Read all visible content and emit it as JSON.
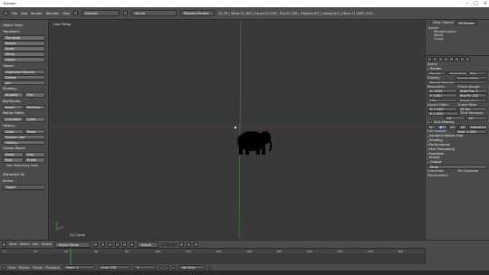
{
  "window": {
    "title": "Blender",
    "controls": [
      "–",
      "□",
      "×"
    ]
  },
  "info_header": {
    "menus": [
      "File",
      "Add",
      "Render",
      "Window",
      "Help"
    ],
    "layout": "Default",
    "scene": "Scene",
    "engine": "Blender Render",
    "stats": "v2.79 | Verts:11,180 | Faces:22,356 | Tris:22,356 | Objects:0/3 | Lamps:0/1 | Mem:11.34M | ELE..."
  },
  "toolshelf": {
    "header": "Object Tools",
    "transform_label": "Transform:",
    "transform": [
      "Translate",
      "Rotate",
      "Scale"
    ],
    "mirror": "Mirror",
    "origin": "Origin",
    "object_label": "Object:",
    "object": [
      "Duplicate Objects",
      "Delete",
      "Join"
    ],
    "shading_label": "Shading:",
    "shading": [
      "Smooth",
      "Flat"
    ],
    "keyframes_label": "Keyframes:",
    "keyframes": [
      "Insert",
      "Remove"
    ],
    "motion_label": "Motion Paths:",
    "motion": [
      "Calculate",
      "Clear"
    ],
    "history_label": "History:",
    "history_undo": [
      "Undo",
      "Redo"
    ],
    "repeat_last": "Repeat Last",
    "history": "History...",
    "grease_label": "Grease Pencil:",
    "grease_draw": [
      "Draw",
      "Line"
    ],
    "grease_poly": [
      "Poly",
      "Erase"
    ],
    "use_sketching": "Use Sketching Sess",
    "operator_header": "(De)select All",
    "action_label": "Action:",
    "action_value": "Toggle"
  },
  "viewport": {
    "label": "User Persp",
    "object_label": "(1) Curve",
    "silhouette": "elephant"
  },
  "outliner": {
    "view": "View",
    "search": "Search",
    "filter": "All Scenes",
    "items": [
      "Scene",
      "RenderLayers",
      "World",
      "Curve"
    ]
  },
  "properties": {
    "scene_label": "Scene",
    "render_header": "Render",
    "render_buttons": [
      "Render",
      "Animation",
      "Play"
    ],
    "display_label": "Display:",
    "display_value": "Image Editor",
    "presets": "Render Presets",
    "resolution_label": "Resolution:",
    "frame_range_label": "Frame Range:",
    "res_x": "X: 1920",
    "res_y": "Y: 1080",
    "res_pct": "50%",
    "start": "Start Fra: 1",
    "end": "End Fr: 250",
    "step": "Frame St: 1",
    "aspect_label": "Aspect Ratio:",
    "frame_rate_label": "Frame Rate:",
    "asp_x": "X: 1.000",
    "asp_y": "Y: 1.000",
    "fps": "24 fps",
    "time_remap_label": "Time Remapp:",
    "remap_old": "10",
    "remap_new": "10",
    "anti_alias": "Anti-Aliasing",
    "aa_values": [
      "5",
      "8",
      "11",
      "16"
    ],
    "aa_filter": "Mitchell-Net",
    "full_sample": "Full Sample",
    "size": "Size: 1.000",
    "sections": [
      "Sampled Motion Blur",
      "Shading",
      "Performance",
      "Post Processing",
      "Freestyle",
      "Stamp",
      "Output"
    ],
    "output_path": "/tmp\\",
    "overwrite": "Overwrite",
    "file_extensions": "File Extensio",
    "placeholders": "Placeholders"
  },
  "view_header": {
    "menus": [
      "View",
      "Select",
      "Add",
      "Object"
    ],
    "mode": "Object Mode",
    "pivot": "Global"
  },
  "timeline": {
    "ticks": [
      "0",
      "20",
      "40",
      "60",
      "80",
      "100",
      "120",
      "140",
      "160",
      "180",
      "200",
      "220",
      "240",
      "260"
    ],
    "menus": [
      "View",
      "Marker",
      "Frame",
      "Playback"
    ],
    "start": "Start: 1",
    "end": "End: 250",
    "current": "1",
    "sync": "No Sync"
  },
  "colors": {
    "bg": "#393939",
    "panel": "#4a4a4a",
    "x_axis": "#8a3b3b",
    "y_axis": "#4f8a4f",
    "silhouette": "#000000"
  }
}
